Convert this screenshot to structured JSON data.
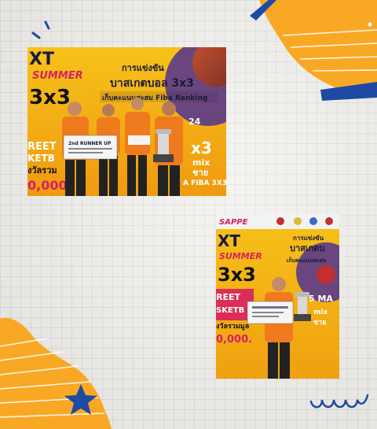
{
  "photos": [
    {
      "event_series": "3x3",
      "title_line1": "การแข่งขัน",
      "title_line2": "บาสเกตบอล 3x3",
      "title_line3": "เก็บคะแนนสะสม Fiba Ranking",
      "banner_left_1": "XT",
      "banner_left_2": "SUMMER",
      "banner_left_3": "3x3",
      "banner_left_4": "REET",
      "banner_left_5": "KETB",
      "banner_left_6": "งวัลรวม",
      "banner_left_7": "0,000",
      "banner_right_1": "x3",
      "banner_right_2": "mix",
      "banner_right_3": "ชาย",
      "banner_right_4": "A FIBA 3X3",
      "banner_right_5": "24",
      "certificate_title": "2nd RUNNER UP",
      "trophy": "trophy"
    },
    {
      "sponsor": "SAPPE",
      "title_line1": "การแข่งขัน",
      "title_line2": "บาสเกตบ",
      "title_line3": "เก็บคะแนนสะสม",
      "banner_left_1": "XT",
      "banner_left_2": "SUMMER",
      "banner_left_3": "3x3",
      "banner_left_4": "REET",
      "banner_left_5": "SKETB",
      "banner_left_6": "งวัลรวมมูล",
      "banner_left_7": "0,000.",
      "banner_right_1": "5 MA",
      "banner_right_2": "mix",
      "banner_right_3": "ชาย",
      "trophy": "trophy"
    }
  ],
  "decor": {
    "orange": "#f9a825",
    "navy": "#1f4aa3",
    "paper": "#efeeea"
  }
}
